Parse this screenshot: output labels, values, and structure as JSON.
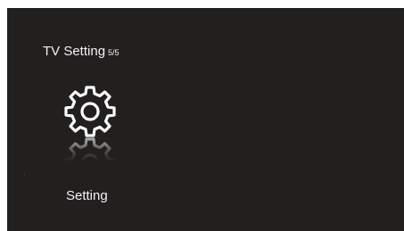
{
  "header": {
    "title": "TV Setting",
    "page_indicator": "5/5"
  },
  "menu": {
    "items": [
      {
        "label": "Setting",
        "icon": "gear-icon",
        "selected": true
      }
    ]
  },
  "nav": {
    "left_arrow": "‹"
  },
  "colors": {
    "background": "#221f1f",
    "text": "#f2f2f2",
    "icon": "#ffffff"
  }
}
